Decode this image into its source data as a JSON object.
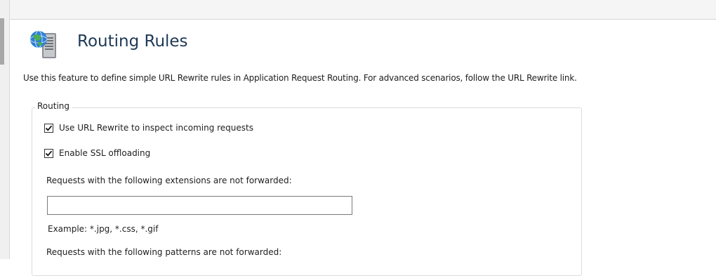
{
  "page": {
    "title": "Routing Rules",
    "description": "Use this feature to define simple URL Rewrite rules in Application Request Routing.  For advanced scenarios, follow the URL Rewrite link.",
    "icon": "globe-server-icon"
  },
  "routing_group": {
    "legend": "Routing",
    "use_url_rewrite": {
      "label": "Use URL Rewrite to inspect incoming requests",
      "checked": true
    },
    "enable_ssl_offloading": {
      "label": "Enable SSL offloading",
      "checked": true
    },
    "extensions_label": "Requests with the following extensions are not forwarded:",
    "extensions_value": "",
    "extensions_example": "Example: *.jpg, *.css, *.gif",
    "patterns_label": "Requests with the following patterns are not forwarded:"
  },
  "colors": {
    "title": "#1e3956",
    "border": "#dcdcdc"
  }
}
